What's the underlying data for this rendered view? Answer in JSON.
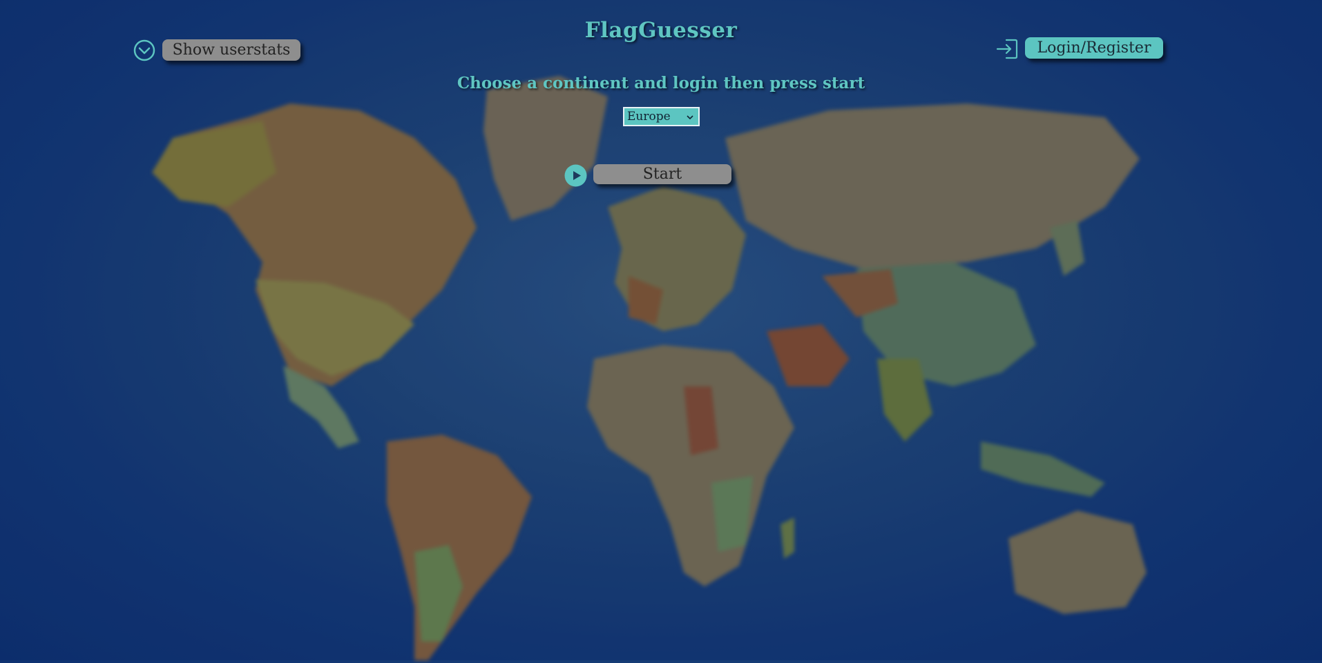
{
  "app": {
    "title": "FlagGuesser",
    "instruction": "Choose a continent and login then press start"
  },
  "continent_select": {
    "selected": "Europe",
    "options": [
      "Europe"
    ]
  },
  "buttons": {
    "userstats_label": "Show userstats",
    "login_label": "Login/Register",
    "start_label": "Start"
  },
  "icons": {
    "userstats": "chevron-down-circle-icon",
    "login": "login-arrow-icon",
    "start": "play-circle-icon"
  },
  "colors": {
    "accent": "#5cc5c1",
    "button_grey": "#8e8e8e",
    "background": "#123774"
  }
}
